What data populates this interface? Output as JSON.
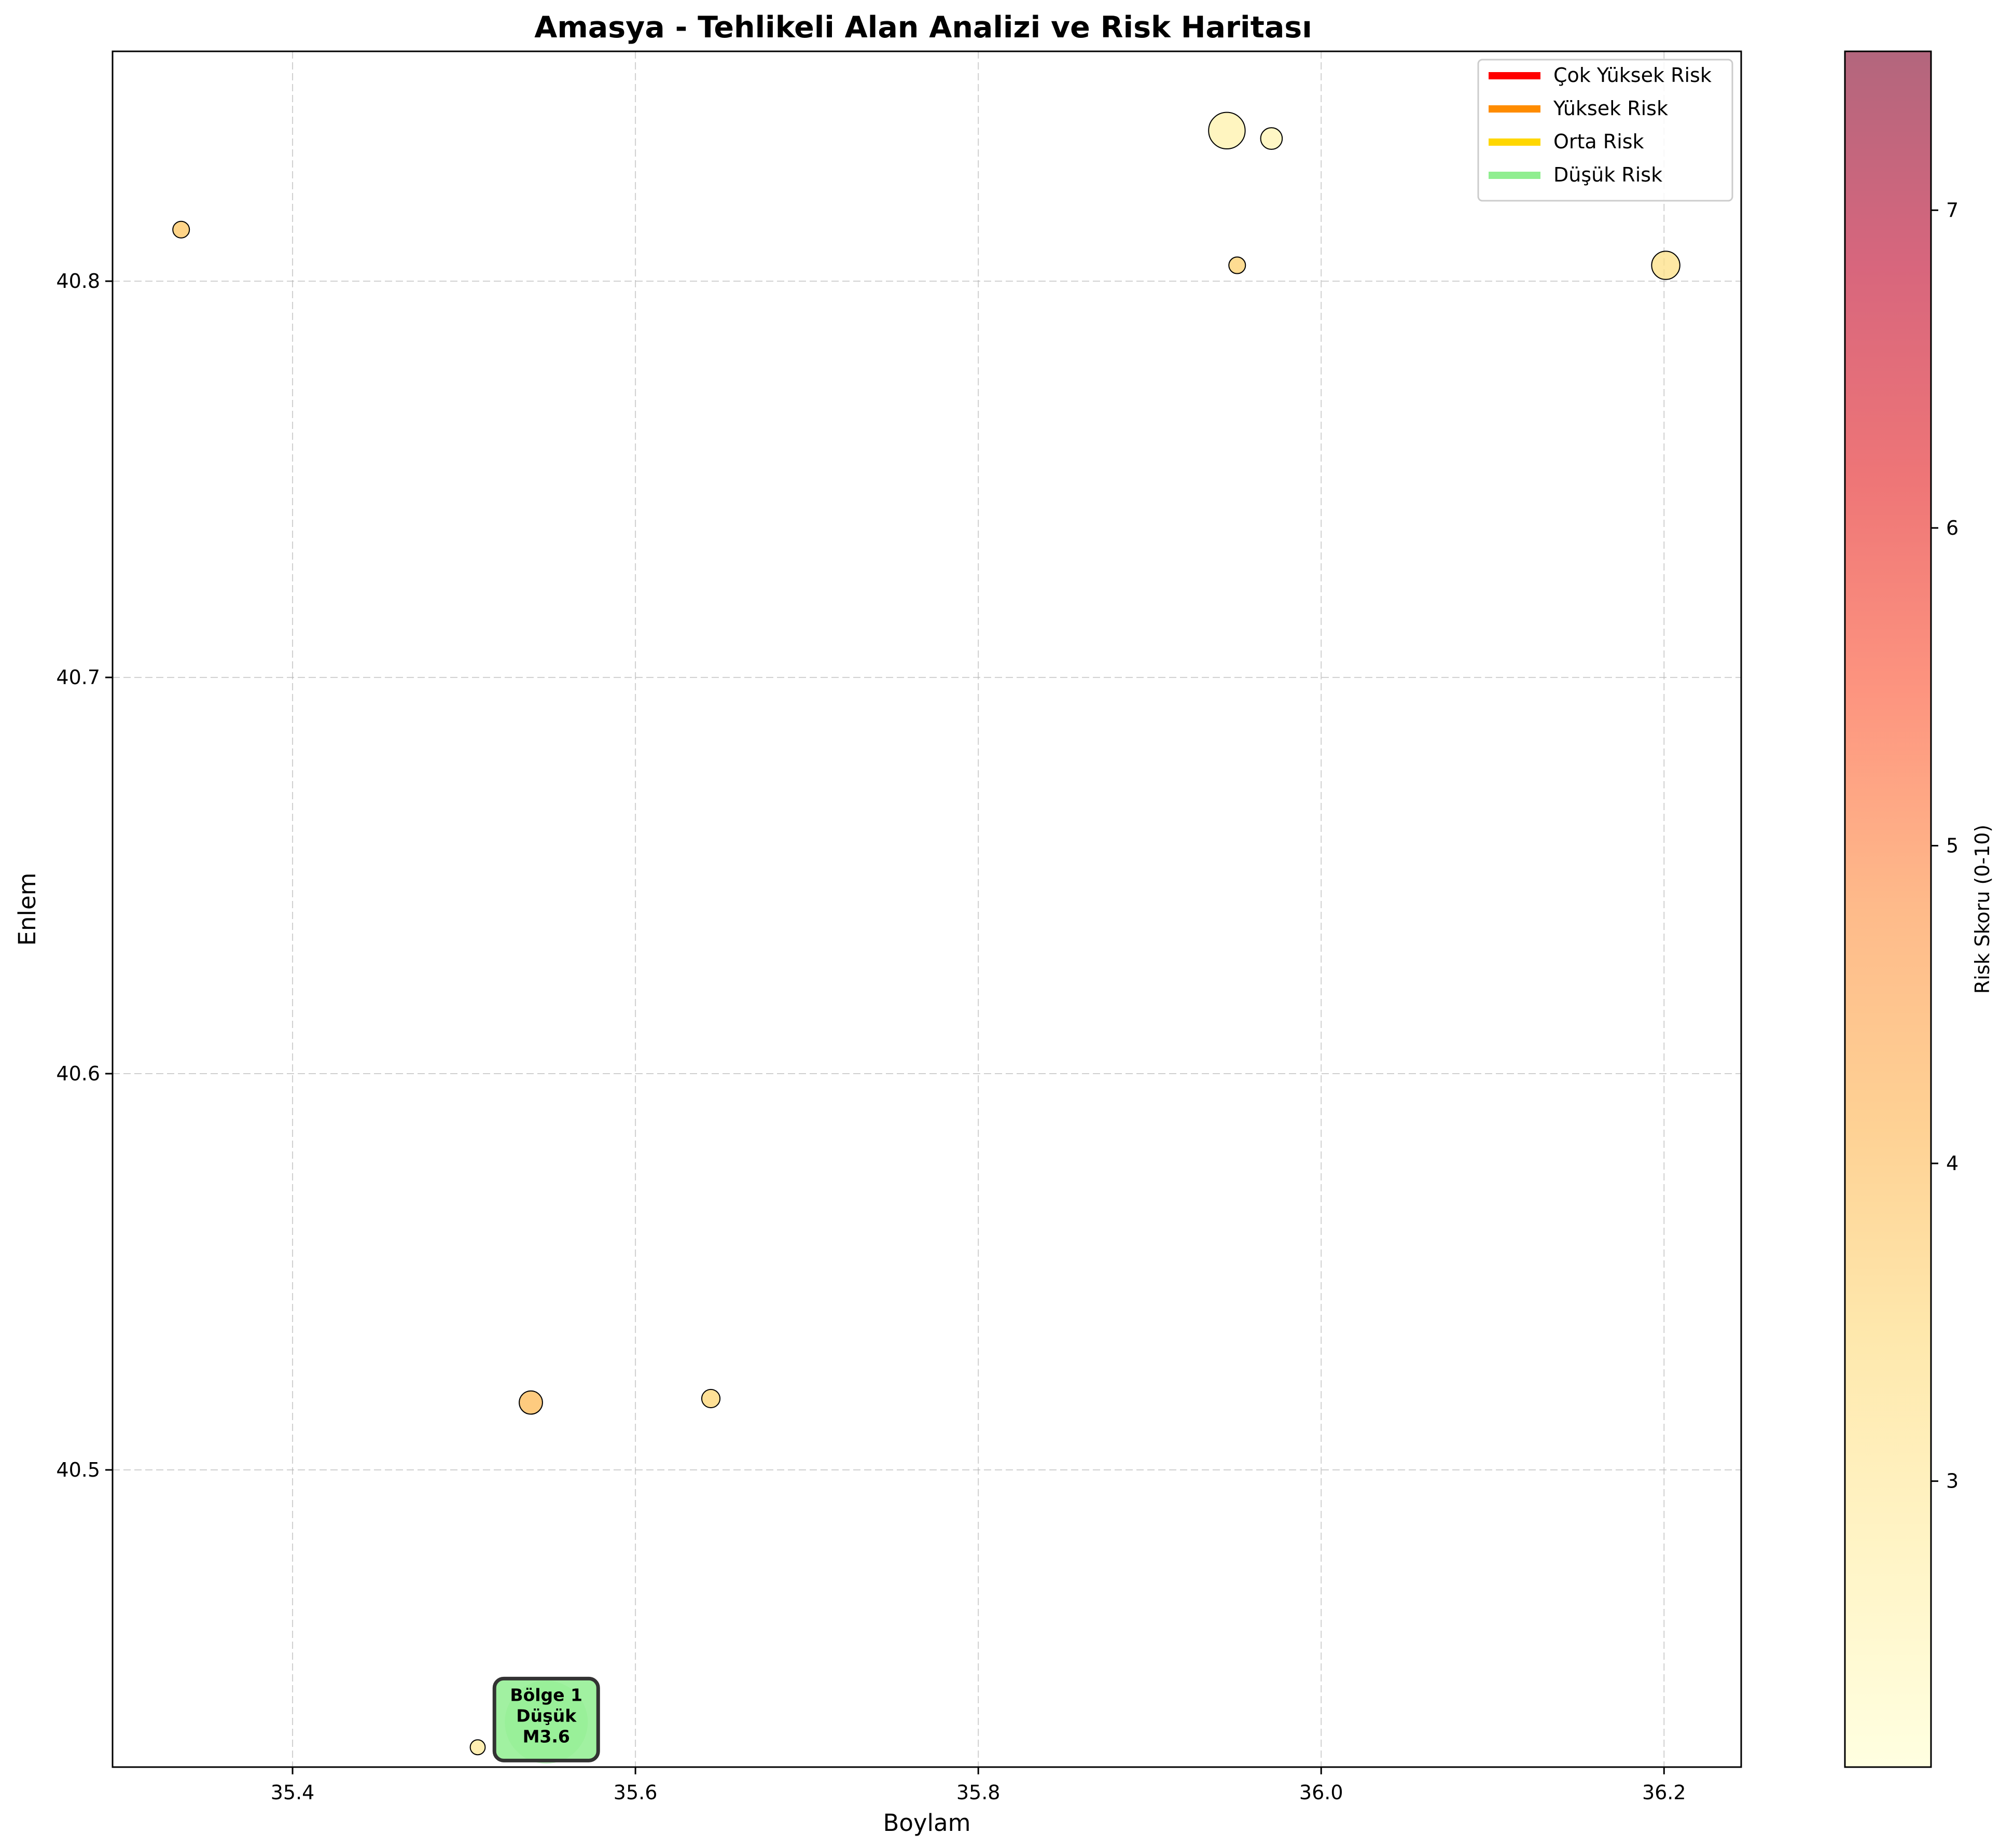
{
  "chart_data": {
    "type": "scatter",
    "title": "Amasya - Tehlikeli Alan Analizi ve Risk Haritası",
    "xlabel": "Boylam",
    "ylabel": "Enlem",
    "xlim": [
      35.295,
      36.245
    ],
    "ylim": [
      40.425,
      40.858
    ],
    "xticks": [
      35.4,
      35.6,
      35.8,
      36.0,
      36.2
    ],
    "xtick_labels": [
      "35.4",
      "35.6",
      "35.8",
      "36.0",
      "36.2"
    ],
    "yticks": [
      40.5,
      40.6,
      40.7,
      40.8
    ],
    "ytick_labels": [
      "40.5",
      "40.6",
      "40.7",
      "40.8"
    ],
    "grid": true,
    "legend_position": "top-right",
    "legend": [
      {
        "label": "Çok Yüksek Risk",
        "color": "#ff0000"
      },
      {
        "label": "Yüksek Risk",
        "color": "#ff8c00"
      },
      {
        "label": "Orta Risk",
        "color": "#ffd700"
      },
      {
        "label": "Düşük Risk",
        "color": "#90ee90"
      }
    ],
    "colorbar": {
      "label": "Risk Skoru (0-10)",
      "range": [
        2.1,
        7.5
      ],
      "ticks": [
        3,
        4,
        5,
        6,
        7
      ],
      "tick_labels": [
        "3",
        "4",
        "5",
        "6",
        "7"
      ],
      "colormap": "YlOrRd"
    },
    "points": [
      {
        "x": 35.335,
        "y": 40.813,
        "risk": 3.8,
        "size": 1.0
      },
      {
        "x": 35.945,
        "y": 40.838,
        "risk": 2.6,
        "size": 2.2
      },
      {
        "x": 35.971,
        "y": 40.836,
        "risk": 2.5,
        "size": 1.3
      },
      {
        "x": 35.951,
        "y": 40.804,
        "risk": 3.6,
        "size": 1.0
      },
      {
        "x": 36.201,
        "y": 40.804,
        "risk": 3.2,
        "size": 1.7
      },
      {
        "x": 35.539,
        "y": 40.517,
        "risk": 4.0,
        "size": 1.4
      },
      {
        "x": 35.644,
        "y": 40.518,
        "risk": 3.5,
        "size": 1.1
      },
      {
        "x": 35.508,
        "y": 40.43,
        "risk": 2.9,
        "size": 0.9
      }
    ],
    "zones": [
      {
        "label_lines": [
          "Bölge 1",
          "Düşük",
          "M3.6"
        ],
        "x": 35.548,
        "y": 40.437,
        "color": "#90ee90"
      }
    ]
  }
}
